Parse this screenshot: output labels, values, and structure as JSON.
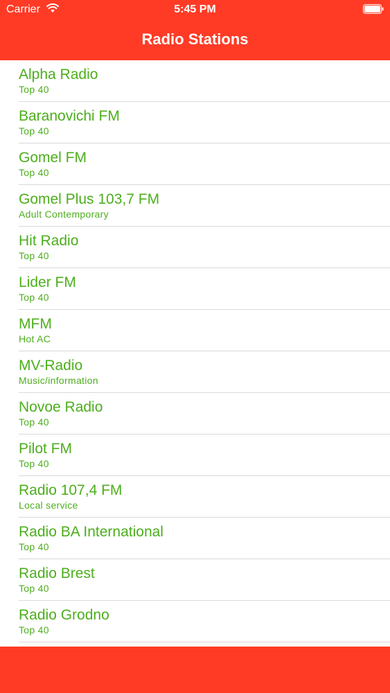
{
  "status_bar": {
    "carrier": "Carrier",
    "time": "5:45 PM",
    "wifi_icon": "wifi-icon",
    "battery_icon": "battery-full-icon"
  },
  "nav": {
    "title": "Radio Stations"
  },
  "colors": {
    "bar": "#ff3b26",
    "station_text": "#4cae1c",
    "separator": "#d9d9d9"
  },
  "stations": [
    {
      "name": "Alpha Radio",
      "genre": "Top 40"
    },
    {
      "name": "Baranovichi FM",
      "genre": "Top 40"
    },
    {
      "name": "Gomel FM",
      "genre": "Top 40"
    },
    {
      "name": "Gomel Plus 103,7 FM",
      "genre": "Adult Contemporary"
    },
    {
      "name": "Hit Radio",
      "genre": "Top 40"
    },
    {
      "name": "Lider FM",
      "genre": "Top 40"
    },
    {
      "name": "MFM",
      "genre": "Hot AC"
    },
    {
      "name": "MV-Radio",
      "genre": "Music/information"
    },
    {
      "name": "Novoe Radio",
      "genre": "Top 40"
    },
    {
      "name": "Pilot FM",
      "genre": "Top 40"
    },
    {
      "name": "Radio 107,4 FM",
      "genre": "Local service"
    },
    {
      "name": "Radio BA International",
      "genre": "Top 40"
    },
    {
      "name": "Radio Brest",
      "genre": "Top 40"
    },
    {
      "name": "Radio Grodno",
      "genre": "Top 40"
    }
  ]
}
